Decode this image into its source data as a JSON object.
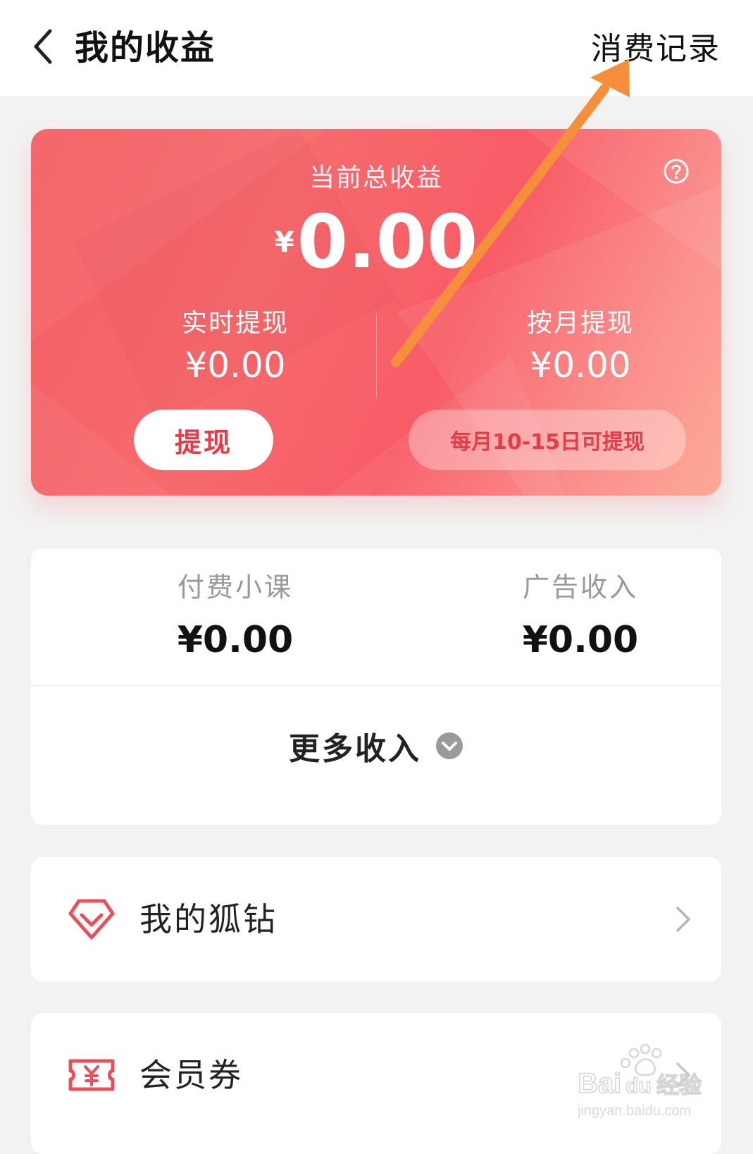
{
  "header": {
    "title": "我的收益",
    "right_link": "消费记录"
  },
  "earnings": {
    "title": "当前总收益",
    "currency": "¥",
    "total": "0.00",
    "realtime": {
      "label": "实时提现",
      "amount": "¥0.00",
      "button": "提现"
    },
    "monthly": {
      "label": "按月提现",
      "amount": "¥0.00",
      "note": "每月10-15日可提现"
    }
  },
  "income": {
    "items": [
      {
        "label": "付费小课",
        "value": "¥0.00"
      },
      {
        "label": "广告收入",
        "value": "¥0.00"
      }
    ],
    "more": "更多收入"
  },
  "menu": {
    "items": [
      {
        "label": "我的狐钻",
        "icon": "diamond-icon"
      },
      {
        "label": "会员券",
        "icon": "voucher-icon"
      }
    ]
  },
  "watermark": {
    "brand": "Baidu经验",
    "url": "jingyan.baidu.com"
  },
  "colors": {
    "accent": "#f4606a",
    "annotation": "#f58f3c"
  }
}
